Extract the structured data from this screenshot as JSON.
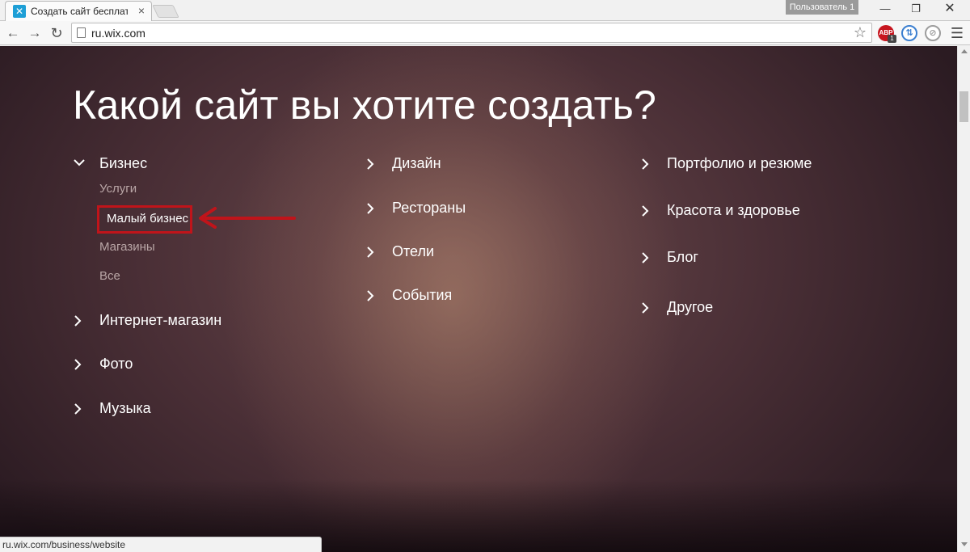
{
  "browser": {
    "tab_title": "Создать сайт бесплатно |",
    "tab_favicon": "wix-favicon-icon",
    "profile_label": "Пользователь 1",
    "url": "ru.wix.com",
    "extensions": {
      "abp_label": "ABP",
      "abp_count": "1"
    },
    "status_url": "ru.wix.com/business/website"
  },
  "page": {
    "headline": "Какой сайт вы хотите создать?",
    "columns": [
      {
        "items": [
          {
            "label": "Бизнес",
            "expanded": true,
            "subitems": [
              "Услуги",
              "Малый бизнес",
              "Магазины",
              "Все"
            ],
            "highlighted_subitem": "Малый бизнес"
          },
          {
            "label": "Интернет-магазин",
            "expanded": false
          },
          {
            "label": "Фото",
            "expanded": false
          },
          {
            "label": "Музыка",
            "expanded": false
          }
        ]
      },
      {
        "items": [
          {
            "label": "Дизайн",
            "expanded": false
          },
          {
            "label": "Рестораны",
            "expanded": false
          },
          {
            "label": "Отели",
            "expanded": false
          },
          {
            "label": "События",
            "expanded": false
          }
        ]
      },
      {
        "items": [
          {
            "label": "Портфолио и резюме",
            "expanded": false
          },
          {
            "label": "Красота и здоровье",
            "expanded": false
          },
          {
            "label": "Блог",
            "expanded": false
          },
          {
            "label": "Другое",
            "expanded": false
          }
        ]
      }
    ]
  },
  "colors": {
    "annotation_red": "#c0141a",
    "subitem_muted": "#b9a6a6",
    "text": "#ffffff"
  }
}
